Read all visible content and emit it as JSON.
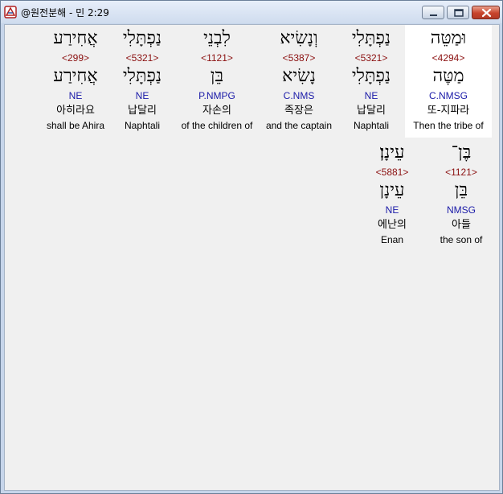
{
  "window": {
    "title": "@원전분해 - 민 2:29"
  },
  "row1": [
    {
      "hebrew": "וּמַטֵּה",
      "strong": "<4294>",
      "root": "מַטֶּה",
      "parse": "C.NMSG",
      "korean": "또-지파라",
      "english": "Then the tribe of"
    },
    {
      "hebrew": "נַפְתָּלִי",
      "strong": "<5321>",
      "root": "נַפְתָּלִי",
      "parse": "NE",
      "korean": "납달리",
      "english": "Naphtali"
    },
    {
      "hebrew": "וְנָשִׂיא",
      "strong": "<5387>",
      "root": "נָשִׂיא",
      "parse": "C.NMS",
      "korean": "족장은",
      "english": "and the captain"
    },
    {
      "hebrew": "לִבְנֵי",
      "strong": "<1121>",
      "root": "בֵּן",
      "parse": "P.NMPG",
      "korean": "자손의",
      "english": "of the children of"
    },
    {
      "hebrew": "נַפְתָּלִי",
      "strong": "<5321>",
      "root": "נַפְתָּלִי",
      "parse": "NE",
      "korean": "납달리",
      "english": "Naphtali"
    },
    {
      "hebrew": "אֲחִירַע",
      "strong": "<299>",
      "root": "אֲחִירַע",
      "parse": "NE",
      "korean": "아히라요",
      "english": "shall be Ahira"
    }
  ],
  "row2": [
    {
      "hebrew": "בֶּן־",
      "strong": "<1121>",
      "root": "בֵּן",
      "parse": "NMSG",
      "korean": "아들",
      "english": "the son of"
    },
    {
      "hebrew": "עֵינָן׃",
      "strong": "<5881>",
      "root": "עֵינָן",
      "parse": "NE",
      "korean": "에난의",
      "english": "Enan"
    }
  ]
}
